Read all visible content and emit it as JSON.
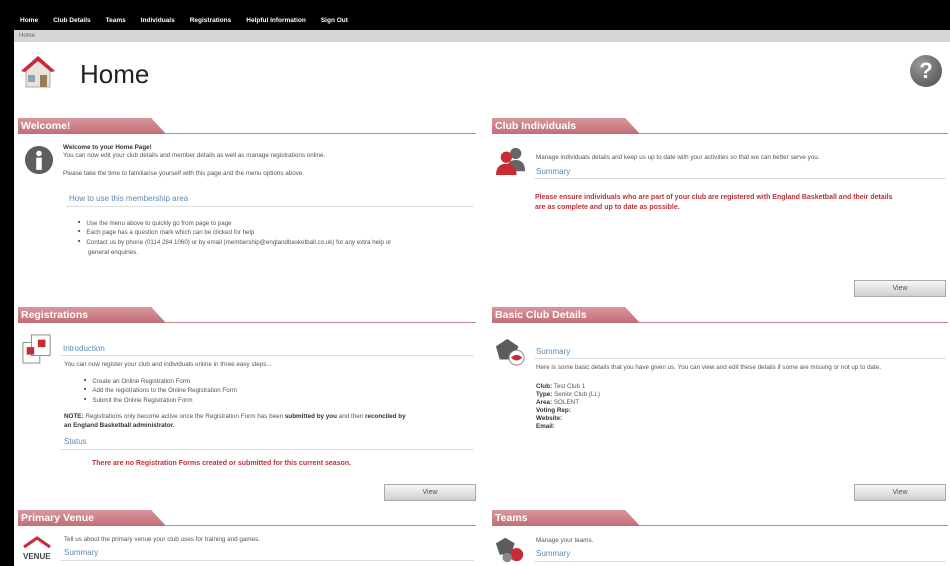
{
  "nav": [
    "Home",
    "Club Details",
    "Teams",
    "Individuals",
    "Registrations",
    "Helpful Information",
    "Sign Out"
  ],
  "breadcrumb": "Home",
  "page_title": "Home",
  "help_glyph": "?",
  "welcome": {
    "title": "Welcome!",
    "heading": "Welcome to your Home Page!",
    "line1": "You can now edit your club details and member details as well as manage registrations online.",
    "line2": "Please take the time to familiarise yourself with this page and the menu options above.",
    "howto": "How to use this membership area",
    "bullets": [
      "Use the menu above to quickly go from page to page",
      "Each page has a question mark which can be clicked for help",
      "Contact us by phone (0114 284 1060) or by email (membership@englandbasketball.co.uk) for any extra help or",
      "general enquiries."
    ]
  },
  "club_individuals": {
    "title": "Club Individuals",
    "line": "Manage individuals details and keep us up to date with your activities so that we can better serve you.",
    "summary": "Summary",
    "warning1": "Please ensure individuals who are part of your club are registered with England Basketball and their details",
    "warning2": "are as complete and up to date as possible.",
    "view": "View"
  },
  "registrations": {
    "title": "Registrations",
    "intro": "Introduction",
    "line": "You can now register your club and individuals online in three easy steps...",
    "steps": [
      "Create an Online Registration Form",
      "Add the registrations to the Online Registration Form",
      "Submit the Online Registration Form"
    ],
    "note_label": "NOTE:",
    "note_a": " Registrations only become active once the Registration Form has been ",
    "note_b": "submitted by you",
    "note_c": " and then ",
    "note_d": "reconciled by",
    "note_e": "an England Basketball administrator",
    "note_f": ".",
    "status": "Status",
    "status_msg": "There are no Registration Forms created or submitted for this current season.",
    "view": "View"
  },
  "basic": {
    "title": "Basic Club Details",
    "summary": "Summary",
    "line": "Here is some basic details that you have given us. You can view and edit these details if some are missing or not up to date.",
    "fields": [
      {
        "label": "Club:",
        "value": "Test Club 1"
      },
      {
        "label": "Type:",
        "value": "Senior Club (LL)"
      },
      {
        "label": "Area:",
        "value": "SOLENT"
      },
      {
        "label": "Voting Rep:",
        "value": ""
      },
      {
        "label": "Website:",
        "value": ""
      },
      {
        "label": "Email:",
        "value": ""
      }
    ],
    "view": "View"
  },
  "venue": {
    "title": "Primary Venue",
    "line": "Tell us about the primary venue your club uses for training and games.",
    "summary": "Summary",
    "icon_text": "VENUE"
  },
  "teams": {
    "title": "Teams",
    "line": "Manage your teams.",
    "summary": "Summary"
  }
}
